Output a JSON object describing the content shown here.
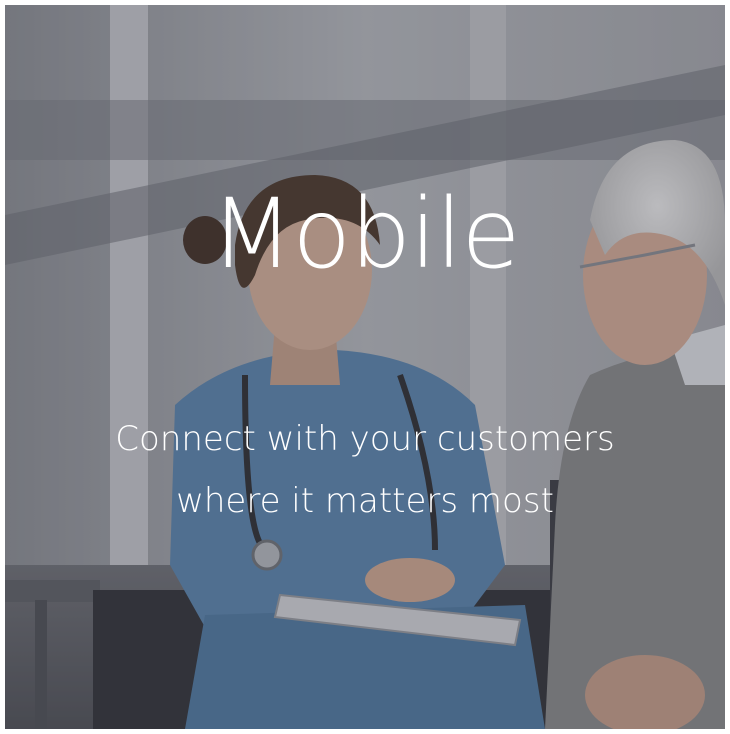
{
  "headline": "Mobile",
  "subtitle": {
    "line1": "Connect with your customers",
    "line2": "where it matters most"
  },
  "colors": {
    "text": "#ffffff",
    "overlay": "#3a3c46",
    "nurse_scrubs": "#5a86b0",
    "sweater": "#8a8b8c",
    "background_window": "#d6d8dc"
  }
}
